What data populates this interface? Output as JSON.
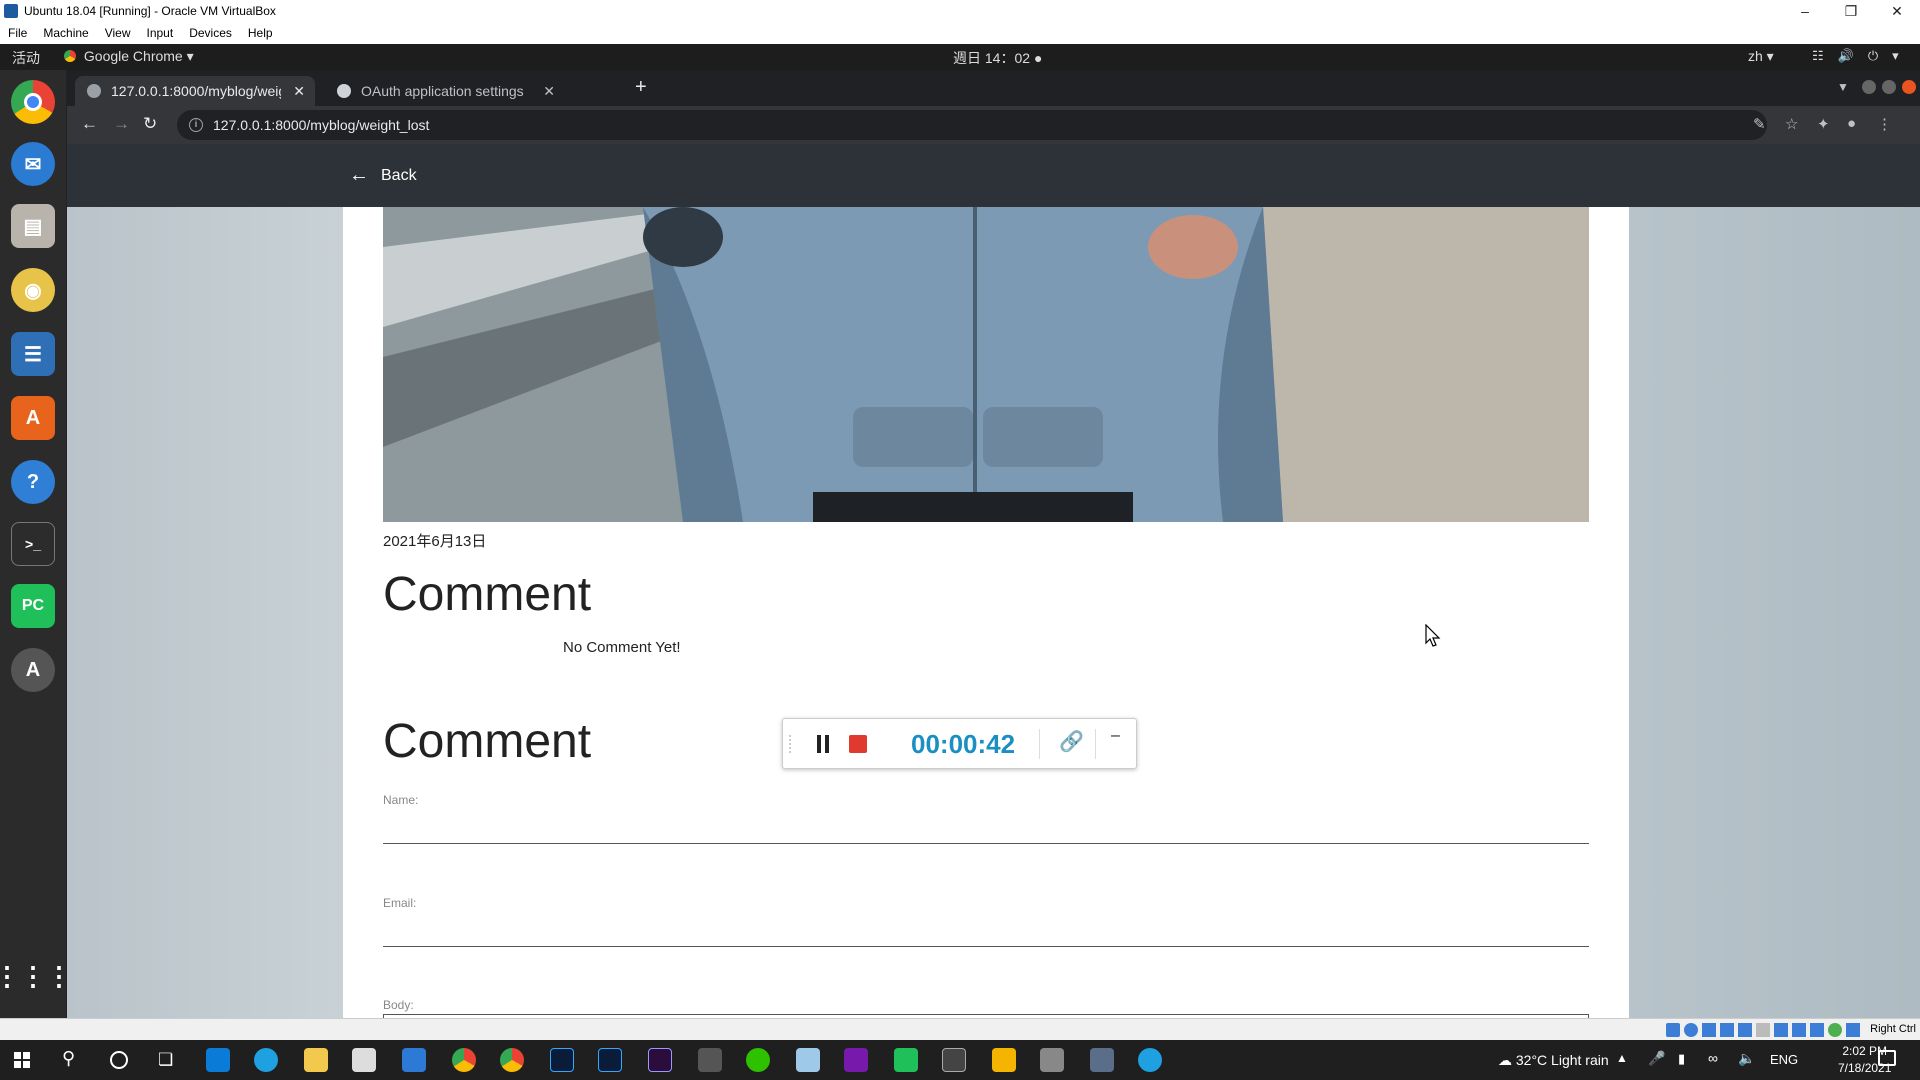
{
  "vbox": {
    "title": "Ubuntu 18.04 [Running] - Oracle VM VirtualBox",
    "menu": [
      "File",
      "Machine",
      "View",
      "Input",
      "Devices",
      "Help"
    ],
    "host_key": "Right Ctrl"
  },
  "gnome": {
    "activities": "活动",
    "app_name": "Google Chrome",
    "clock": "週日 14：02",
    "input_lang": "zh"
  },
  "chrome": {
    "tabs": [
      {
        "label": "127.0.0.1:8000/myblog/weight_lost",
        "active": true
      },
      {
        "label": "OAuth application settings",
        "active": false
      }
    ],
    "url": "127.0.0.1:8000/myblog/weight_lost"
  },
  "page": {
    "back_label": "Back",
    "post_date": "2021年6月13日",
    "comments_heading": "Comment",
    "no_comment_text": "No Comment Yet!",
    "form_heading": "Comment",
    "fields": {
      "name_label": "Name:",
      "email_label": "Email:",
      "body_label": "Body:"
    }
  },
  "recorder": {
    "time": "00:00:42"
  },
  "taskbar": {
    "weather": "32°C  Light rain",
    "lang": "ENG",
    "time": "2:02 PM",
    "date": "7/18/2021"
  }
}
